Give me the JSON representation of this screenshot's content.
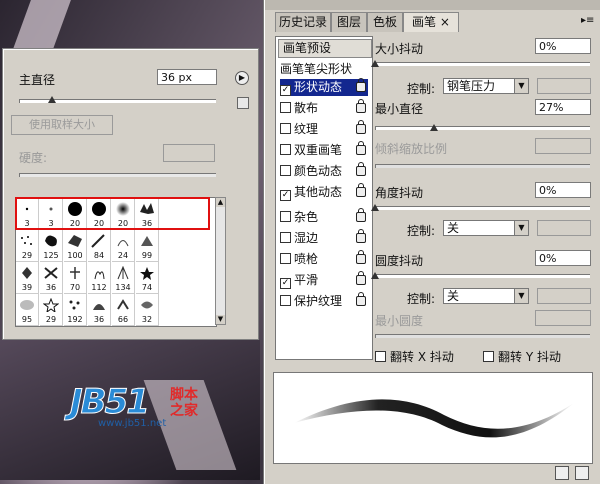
{
  "picker": {
    "master_diameter_label": "主直径",
    "master_diameter_value": "36 px",
    "use_sample_size_label": "使用取样大小",
    "hardness_label": "硬度:",
    "brush_sizes": [
      "3",
      "3",
      "20",
      "20",
      "20",
      "36",
      "29",
      "125",
      "100",
      "84",
      "24",
      "99",
      "39",
      "36",
      "70",
      "112",
      "134",
      "74",
      "95",
      "29",
      "192",
      "36",
      "66",
      "32"
    ]
  },
  "panel": {
    "tabs": [
      "历史记录",
      "图层",
      "色板",
      "画笔"
    ],
    "tab_close": "×",
    "preset_header": "画笔预设",
    "tip_shape": "画笔笔尖形状",
    "options": [
      {
        "label": "形状动态",
        "checked": true,
        "selected": true
      },
      {
        "label": "散布",
        "checked": false
      },
      {
        "label": "纹理",
        "checked": false
      },
      {
        "label": "双重画笔",
        "checked": false
      },
      {
        "label": "颜色动态",
        "checked": false
      },
      {
        "label": "其他动态",
        "checked": true
      },
      {
        "label": "杂色",
        "checked": false
      },
      {
        "label": "湿边",
        "checked": false
      },
      {
        "label": "喷枪",
        "checked": false
      },
      {
        "label": "平滑",
        "checked": true
      },
      {
        "label": "保护纹理",
        "checked": false
      }
    ],
    "size_jitter_label": "大小抖动",
    "size_jitter_value": "0%",
    "control_label": "控制:",
    "control1_value": "钢笔压力",
    "min_diameter_label": "最小直径",
    "min_diameter_value": "27%",
    "tilt_scale_label": "倾斜缩放比例",
    "angle_jitter_label": "角度抖动",
    "angle_jitter_value": "0%",
    "control2_value": "关",
    "roundness_jitter_label": "圆度抖动",
    "roundness_jitter_value": "0%",
    "control3_value": "关",
    "min_roundness_label": "最小圆度",
    "flip_x_label": "翻转 X 抖动",
    "flip_y_label": "翻转 Y 抖动"
  },
  "watermark": {
    "logo_text": "JB51",
    "cn_top": "脚本",
    "cn_bottom": "之家",
    "url": "www.jb51.net"
  }
}
